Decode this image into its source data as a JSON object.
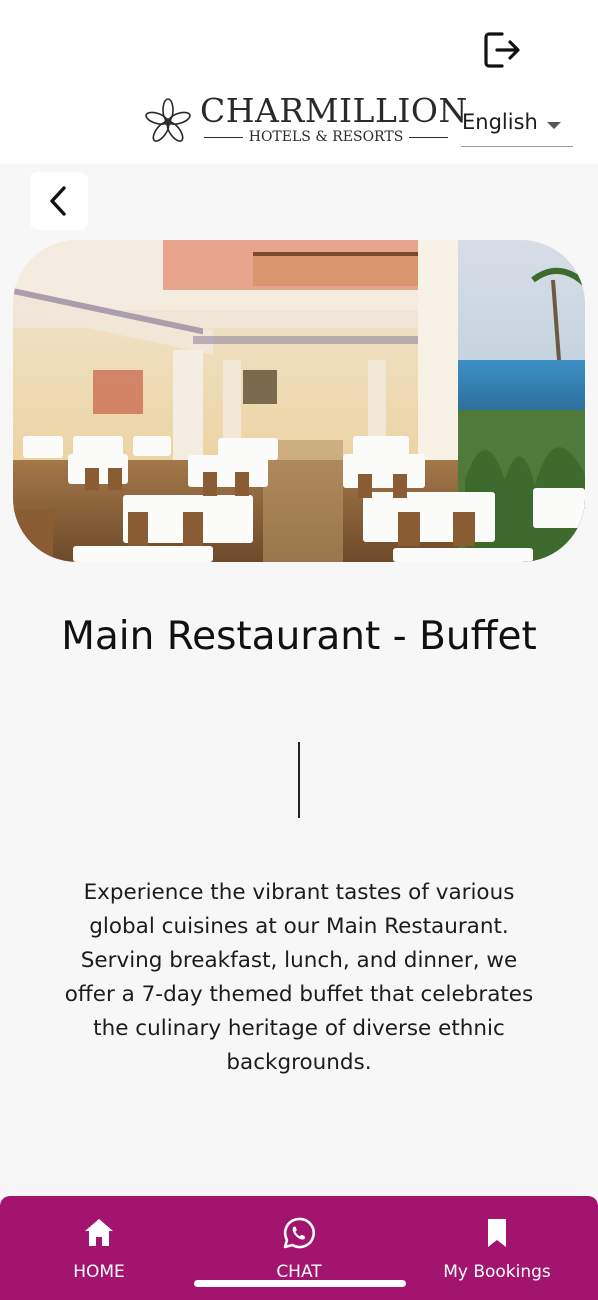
{
  "header": {
    "brand_name": "CHARMILLION",
    "brand_subtitle": "HOTELS & RESORTS",
    "language": "English",
    "logout_icon": "logout-icon",
    "back_icon": "chevron-left-icon"
  },
  "page": {
    "title": "Main Restaurant - Buffet",
    "description": "Experience the vibrant tastes of various global cuisines at our Main Restaurant. Serving breakfast, lunch, and dinner, we offer a 7-day themed buffet that celebrates the culinary heritage of diverse ethnic backgrounds."
  },
  "nav": {
    "items": [
      {
        "label": "HOME",
        "icon": "home-icon"
      },
      {
        "label": "CHAT",
        "icon": "whatsapp-icon"
      },
      {
        "label": "My Bookings",
        "icon": "bookmark-icon"
      }
    ]
  },
  "colors": {
    "accent": "#a3146f",
    "background": "#f8f7f8",
    "header": "#ffffff"
  }
}
